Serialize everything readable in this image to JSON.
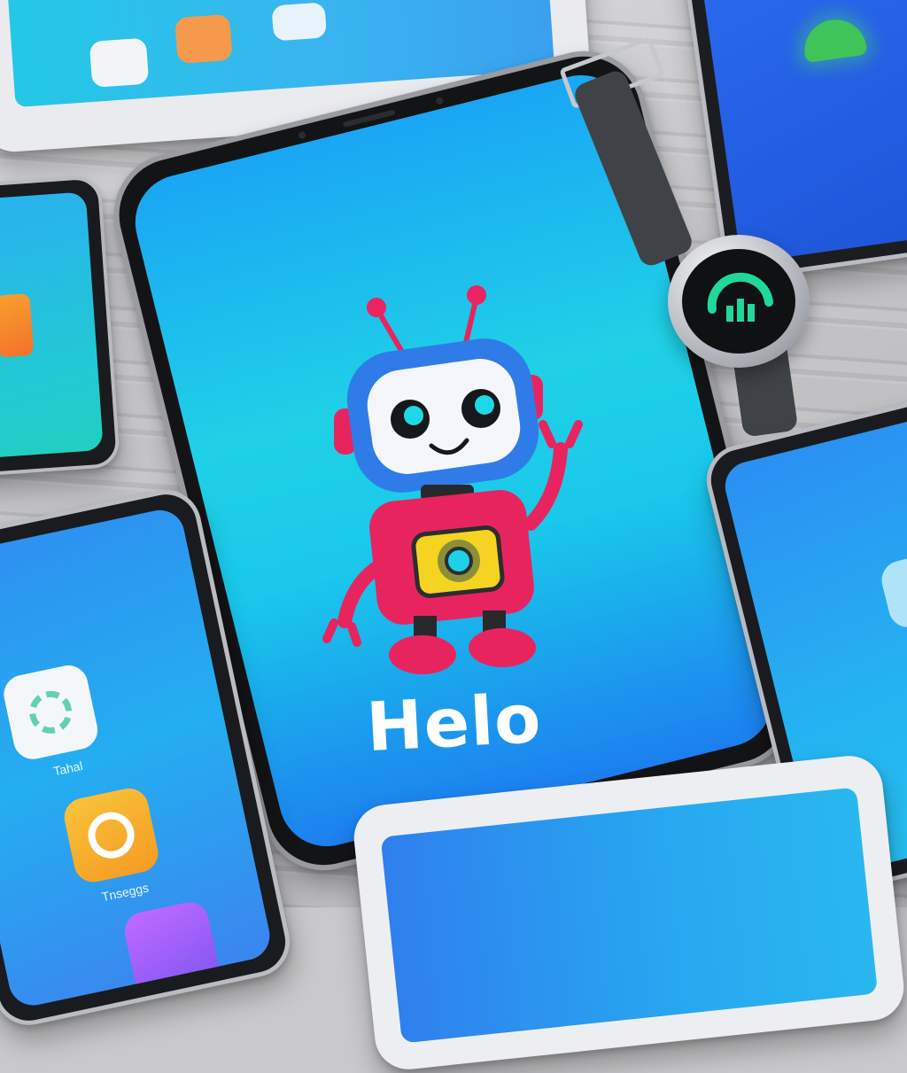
{
  "scene": {
    "greeting_text": "Helo",
    "robot_description_icon": "robot-icon",
    "app_labels": [
      "Tahal",
      "Tnseggs"
    ]
  },
  "colors": {
    "screen_cyan": "#1fd1e6",
    "screen_blue": "#1c7ff0",
    "robot_pink": "#e8245f",
    "robot_blue": "#2f7ce8",
    "robot_yellow": "#f4d420",
    "watch_green": "#1fd89a"
  }
}
